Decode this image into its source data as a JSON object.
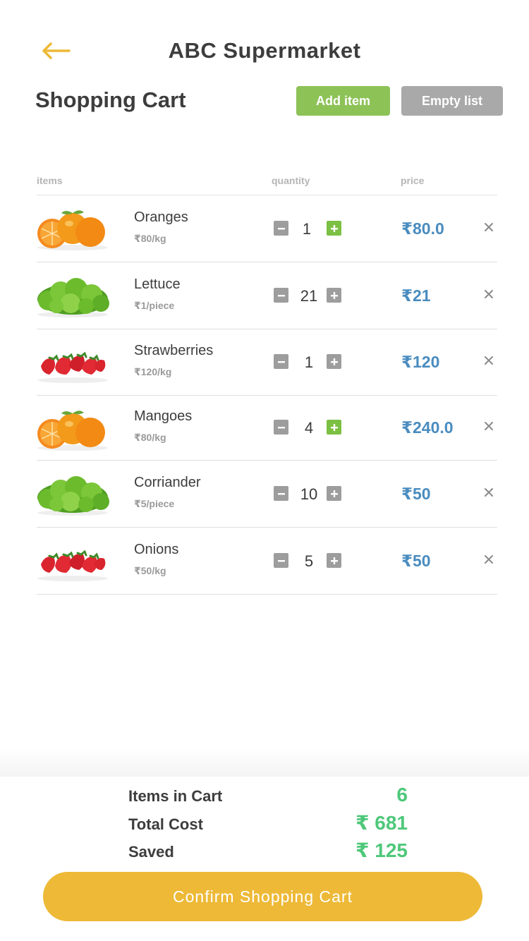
{
  "header": {
    "title": "ABC Supermarket",
    "back_icon": "arrow-left-icon",
    "accent_color": "#edb937"
  },
  "page": {
    "title": "Shopping Cart",
    "add_item_label": "Add item",
    "empty_list_label": "Empty list"
  },
  "columns": {
    "items": "items",
    "quantity": "quantity",
    "price": "price"
  },
  "cart_items": [
    {
      "name": "Oranges",
      "unit_price": "₹80/kg",
      "quantity": "1",
      "price": "₹80.0",
      "image": "oranges",
      "plus_color": "green"
    },
    {
      "name": "Lettuce",
      "unit_price": "₹1/piece",
      "quantity": "21",
      "price": "₹21",
      "image": "lettuce",
      "plus_color": "grey"
    },
    {
      "name": "Strawberries",
      "unit_price": "₹120/kg",
      "quantity": "1",
      "price": "₹120",
      "image": "strawberries",
      "plus_color": "grey"
    },
    {
      "name": "Mangoes",
      "unit_price": "₹80/kg",
      "quantity": "4",
      "price": "₹240.0",
      "image": "oranges",
      "plus_color": "green"
    },
    {
      "name": "Corriander",
      "unit_price": "₹5/piece",
      "quantity": "10",
      "price": "₹50",
      "image": "lettuce",
      "plus_color": "grey"
    },
    {
      "name": "Onions",
      "unit_price": "₹50/kg",
      "quantity": "5",
      "price": "₹50",
      "image": "strawberries",
      "plus_color": "grey"
    }
  ],
  "summary": {
    "items_label": "Items in Cart",
    "items_value": "6",
    "total_label": "Total Cost",
    "total_value": "₹ 681",
    "saved_label": "Saved",
    "saved_value": "₹ 125"
  },
  "confirm_label": "Confirm Shopping Cart",
  "colors": {
    "add_button": "#8dc257",
    "empty_button": "#a9a9a9",
    "price_text": "#4a8cbf",
    "summary_values": "#4ec87a"
  }
}
